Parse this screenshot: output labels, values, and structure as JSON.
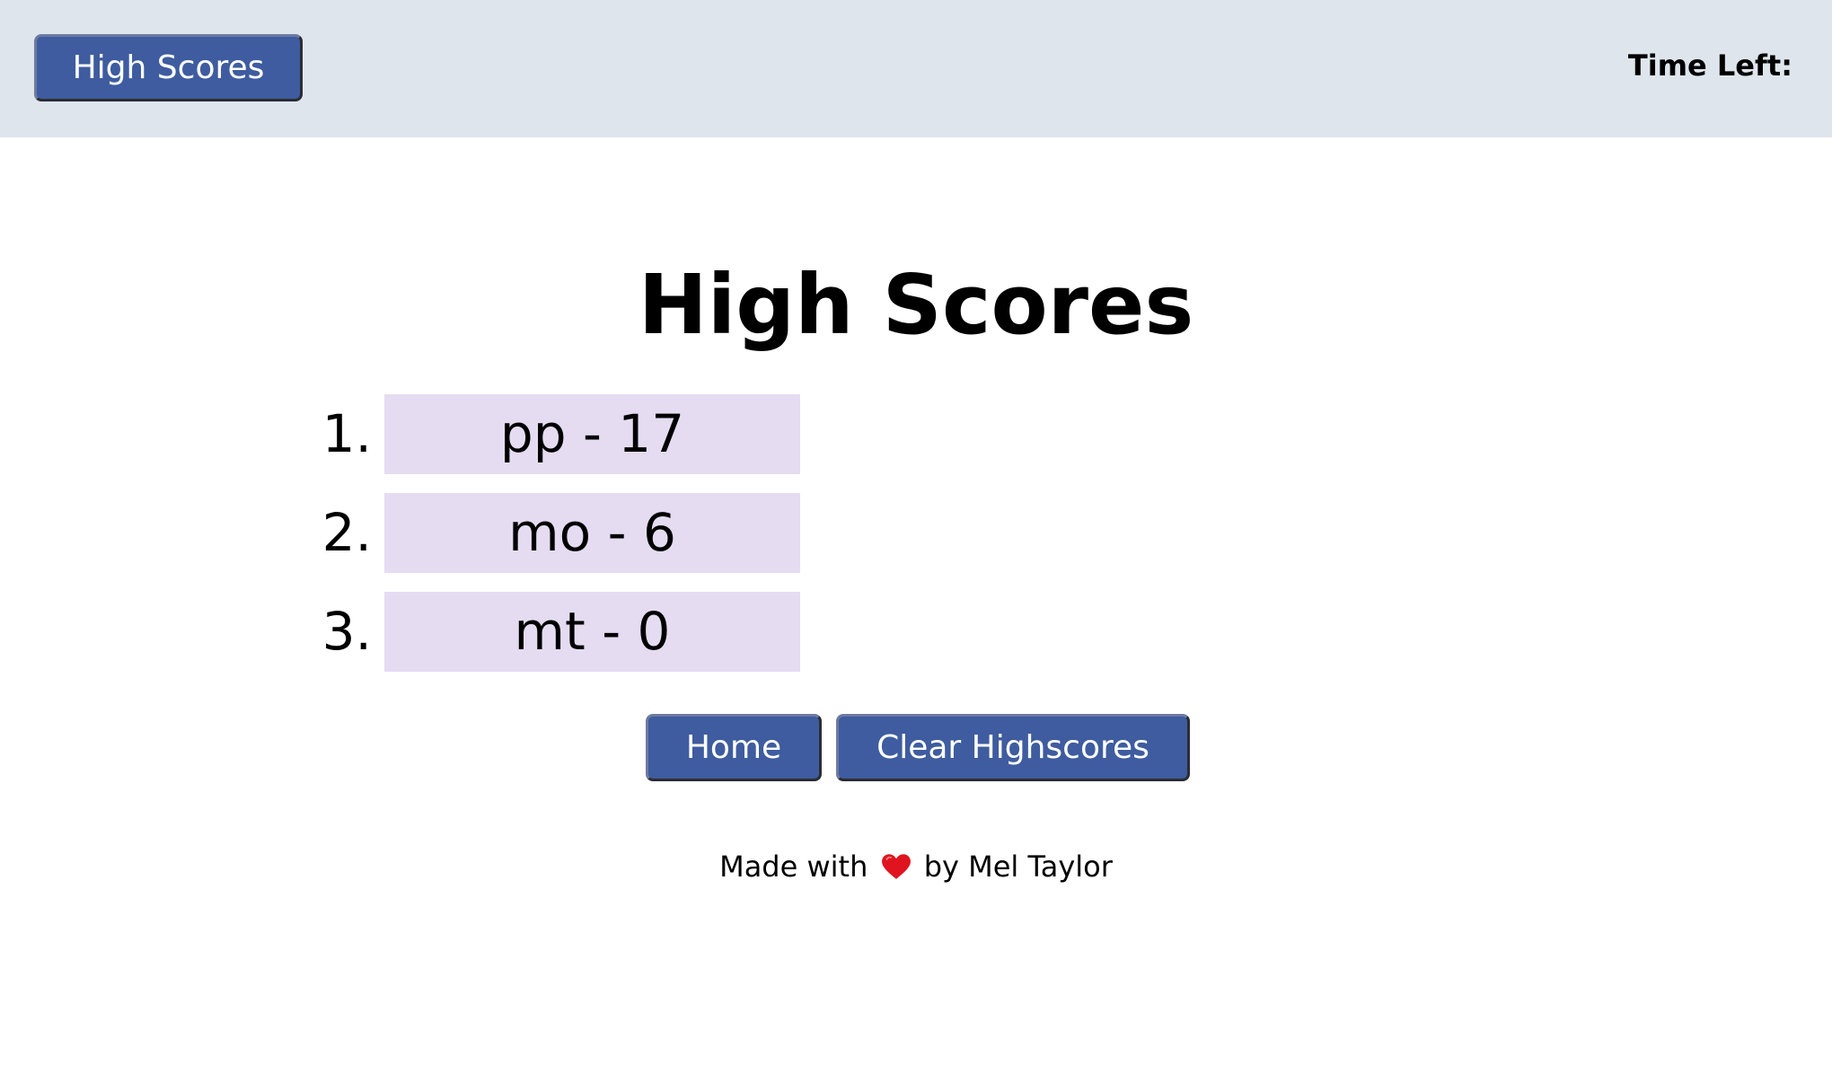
{
  "header": {
    "high_scores_button": "High Scores",
    "time_left_label": "Time Left:"
  },
  "main": {
    "title": "High Scores",
    "scores": [
      {
        "rank": "1.",
        "entry": "pp - 17"
      },
      {
        "rank": "2.",
        "entry": "mo - 6"
      },
      {
        "rank": "3.",
        "entry": "mt - 0"
      }
    ],
    "home_button": "Home",
    "clear_button": "Clear Highscores"
  },
  "footer": {
    "made_with": "Made with",
    "heart_icon": "heart-icon",
    "by_author": "by Mel Taylor"
  },
  "colors": {
    "topbar": "#dfe5ec",
    "button": "#3e5c9f",
    "score_box": "#e5dcf2",
    "heart": "#e0141e"
  }
}
